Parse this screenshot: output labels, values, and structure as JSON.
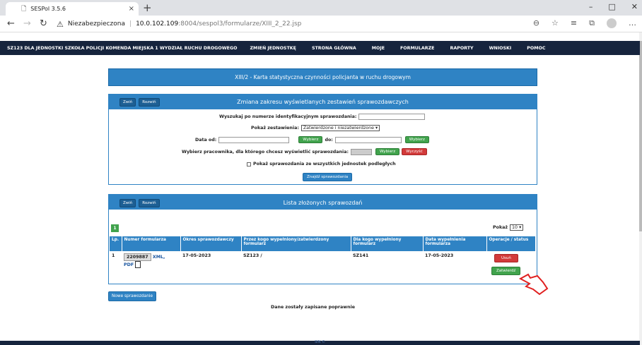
{
  "browser": {
    "tab_title": "SESPol 3.5.6",
    "tab_close": "×",
    "new_tab": "+",
    "security_label": "Niezabezpieczona",
    "url_host": "10.0.102.109",
    "url_path": ":8004/sespol3/formularze/XIII_2_22.jsp",
    "window_controls": [
      "–",
      "□",
      "✕"
    ]
  },
  "topnav": {
    "unit": "SZ123 DLA JEDNOSTKI SZKOŁA POLICJI KOMENDA MIEJSKA 1 WYDZIAŁ RUCHU DROGOWEGO",
    "items": [
      "ZMIEŃ JEDNOSTKĘ",
      "STRONA GŁÓWNA",
      "MOJE",
      "FORMULARZE",
      "RAPORTY",
      "WNIOSKI",
      "POMOC"
    ]
  },
  "page_header": "XIII/2 - Karta statystyczna czynności policjanta w ruchu drogowym",
  "filter_panel": {
    "btn_collapse": "Zwiń",
    "btn_expand": "Rozwiń",
    "title": "Zmiana zakresu wyświetlanych zestawień sprawozdawczych",
    "search_label": "Wyszukaj po numerze identyfikacyjnym sprawozdania:",
    "show_label": "Pokaż zestawienia:",
    "show_value": "Zatwierdzone i niezatwierdzone",
    "date_from_label": "Data od:",
    "date_to_label": "do:",
    "choose_btn": "Wybierz",
    "employee_label": "Wybierz pracownika, dla którego chcesz wyświetlić sprawozdania:",
    "clear_btn": "Wyczyść",
    "subunits_label": "Pokaż sprawozdania ze wszystkich jednostek podległych",
    "find_btn": "Znajdź sprawozdania"
  },
  "list_panel": {
    "btn_collapse": "Zwiń",
    "btn_expand": "Rozwiń",
    "title": "Lista złożonych sprawozdań",
    "page": "1",
    "show_label": "Pokaż",
    "show_value": "10",
    "columns": [
      "Lp.",
      "Numer formularza",
      "Okres sprawozdawczy",
      "Przez kogo wypełniony/zatwierdzony formularz",
      "Dla kogo wypełniony formularz",
      "Data wypełnienia formularza",
      "Operacje / status"
    ],
    "row": {
      "lp": "1",
      "form_no": "2209887",
      "xml": "XML,",
      "pdf": "PDF",
      "period": "17-05-2023",
      "by": "SZ123 /",
      "for": "SZ141",
      "date": "17-05-2023",
      "delete_btn": "Usuń",
      "approve_btn": "Zatwierdź"
    }
  },
  "new_report_btn": "Nowe sprawozdanie",
  "status_message": "Dane zostały zapisane poprawnie",
  "footer_text": "SIN ©",
  "colors": {
    "nav": "#16243d",
    "blue": "#2f83c4",
    "green": "#41a34d",
    "red": "#d23a3a"
  }
}
